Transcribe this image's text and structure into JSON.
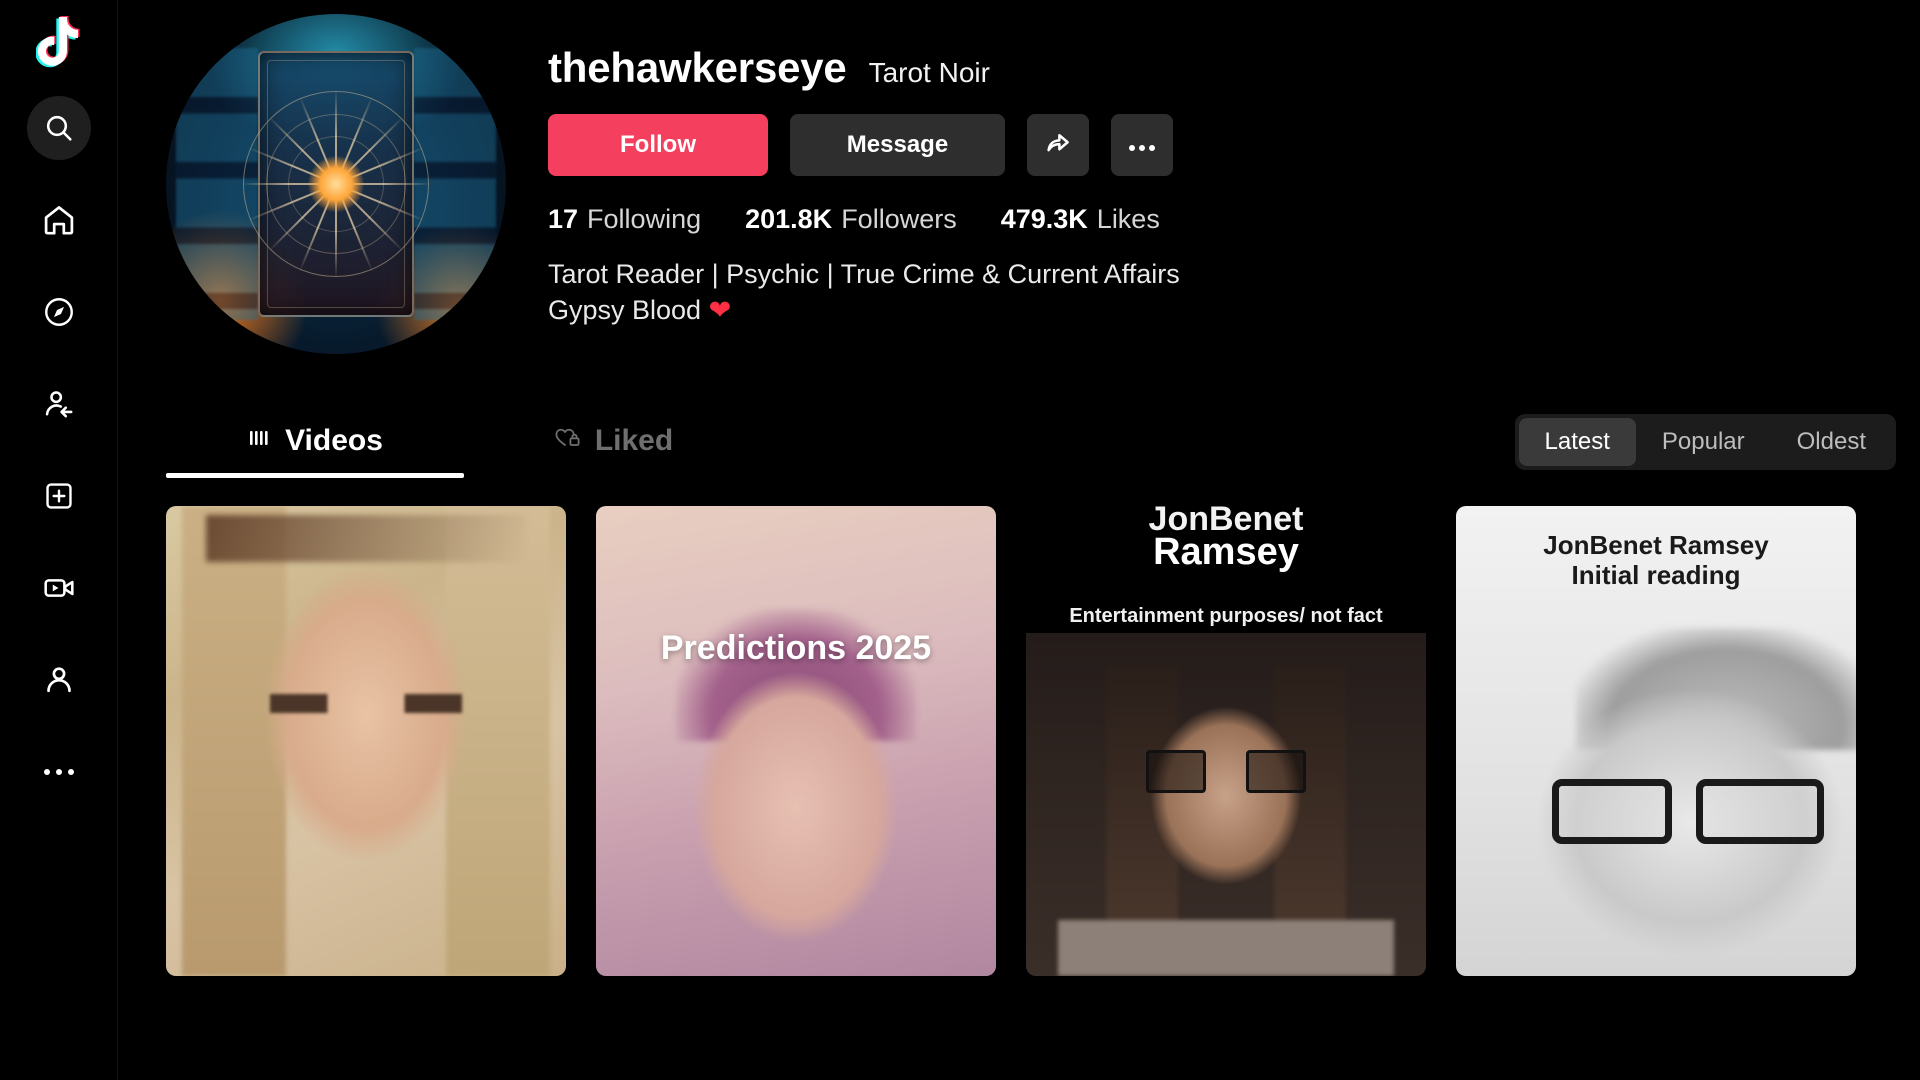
{
  "colors": {
    "background": "#000000",
    "follow_button": "#f43f5e",
    "secondary_button": "#2e2e2e",
    "active_pill": "#3a3a3a",
    "pill_track": "#1c1c1c",
    "text_primary": "#ffffff",
    "text_secondary": "#d6d6d6",
    "tab_inactive": "#6f6f6f",
    "heart": "#ff2f44"
  },
  "sidebar": {
    "logo": "tiktok-logo-icon",
    "items": [
      {
        "name": "search-icon",
        "label": "Search"
      },
      {
        "name": "home-icon",
        "label": "For You"
      },
      {
        "name": "compass-icon",
        "label": "Explore"
      },
      {
        "name": "following-icon",
        "label": "Following"
      },
      {
        "name": "upload-icon",
        "label": "Upload"
      },
      {
        "name": "live-icon",
        "label": "LIVE"
      },
      {
        "name": "profile-icon",
        "label": "Profile"
      },
      {
        "name": "more-icon",
        "label": "More"
      }
    ]
  },
  "profile": {
    "avatar_alt": "tarot-card-mandala-avatar",
    "username": "thehawkerseye",
    "display_name": "Tarot Noir",
    "actions": {
      "follow_label": "Follow",
      "message_label": "Message",
      "share_icon": "share-arrow-icon",
      "more_icon": "ellipsis-icon"
    },
    "stats": [
      {
        "value": "17",
        "label": "Following"
      },
      {
        "value": "201.8K",
        "label": "Followers"
      },
      {
        "value": "479.3K",
        "label": "Likes"
      }
    ],
    "bio_line1": "Tarot Reader | Psychic | True Crime & Current Affairs",
    "bio_line2": "Gypsy Blood",
    "bio_emoji": "❤"
  },
  "tabs": [
    {
      "label": "Videos",
      "icon": "grid-bars-icon",
      "active": true
    },
    {
      "label": "Liked",
      "icon": "heart-lock-icon",
      "active": false
    }
  ],
  "sort": {
    "options": [
      {
        "label": "Latest",
        "active": true
      },
      {
        "label": "Popular",
        "active": false
      },
      {
        "label": "Oldest",
        "active": false
      }
    ]
  },
  "videos": [
    {
      "overlay_top": "",
      "overlay_main": "",
      "overlay_sub": ""
    },
    {
      "overlay_top": "",
      "overlay_main": "Predictions 2025",
      "overlay_sub": ""
    },
    {
      "overlay_top": "JonBenet",
      "overlay_main": "Ramsey",
      "overlay_sub": "Entertainment purposes/ not fact"
    },
    {
      "overlay_top": "JonBenet Ramsey",
      "overlay_main": "Initial reading",
      "overlay_sub": ""
    }
  ]
}
